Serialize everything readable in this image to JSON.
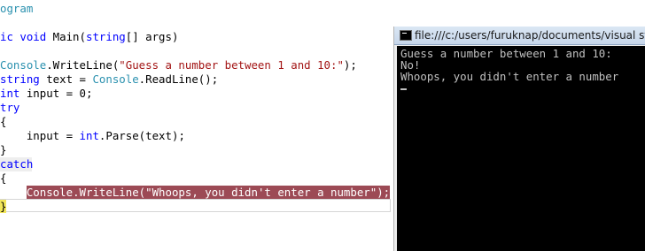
{
  "editor": {
    "line0": "ogram",
    "line2_kw": "ic void",
    "line2_rest": " Main(",
    "line2_type": "string",
    "line2_end": "[] args)",
    "line4_type": "Console",
    "line4_mid": ".WriteLine(",
    "line4_str": "\"Guess a number between 1 and 10:\"",
    "line4_end": ");",
    "line5_kw": "string",
    "line5_mid": " text = ",
    "line5_type": "Console",
    "line5_end": ".ReadLine();",
    "line6_kw": "int",
    "line6_end": " input = 0;",
    "line7_kw": "try",
    "line8": "{",
    "line9_start": "    input = ",
    "line9_kw": "int",
    "line9_end": ".Parse(text);",
    "line10": "}",
    "line11_kw": "catch",
    "line12": "{",
    "line13_indent": "    ",
    "line13_type": "Console",
    "line13_mid": ".WriteLine(",
    "line13_str": "\"Whoops, you didn't enter a number\"",
    "line13_end": ");",
    "line14": "}"
  },
  "console": {
    "title": "file:///c:/users/furuknap/documents/visual st",
    "output": [
      "Guess a number between 1 and 10:",
      "No!",
      "Whoops, you didn't enter a number"
    ]
  }
}
